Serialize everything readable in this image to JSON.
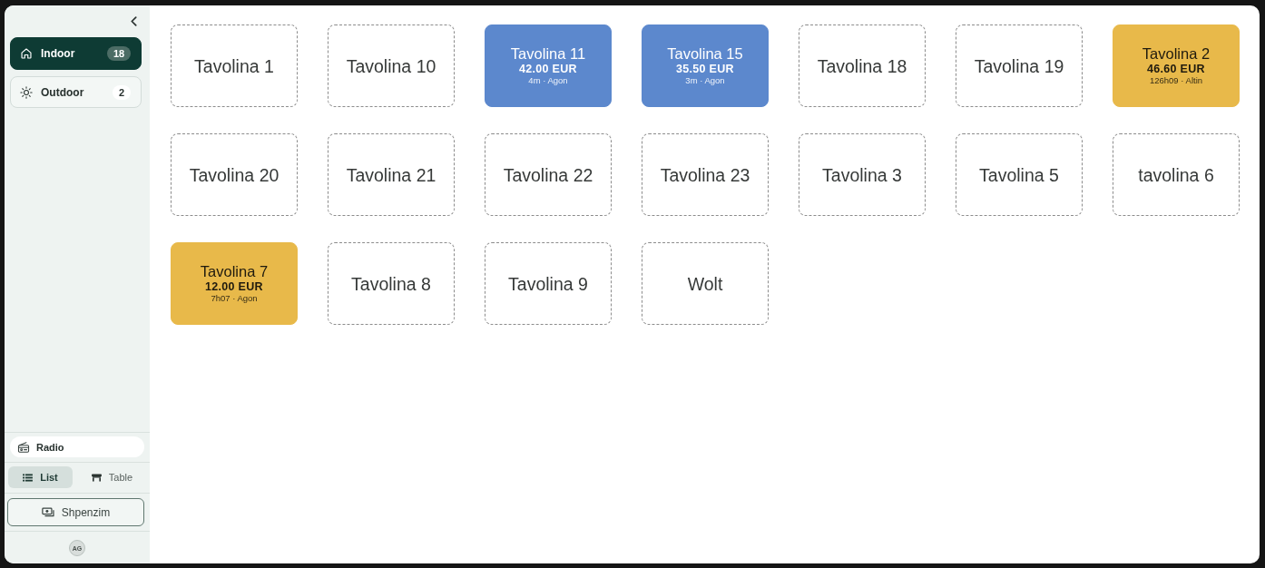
{
  "sidebar": {
    "areas": [
      {
        "label": "Indoor",
        "count": "18",
        "selected": true
      },
      {
        "label": "Outdoor",
        "count": "2",
        "selected": false
      }
    ],
    "radio": {
      "label": "Radio",
      "on": true
    },
    "view_toggle": [
      {
        "label": "List",
        "selected": true
      },
      {
        "label": "Table",
        "selected": false
      }
    ],
    "expense_button": {
      "label": "Shpenzim"
    },
    "user": {
      "initials": "AG"
    }
  },
  "tables": [
    {
      "name": "Tavolina 1",
      "kind": "free"
    },
    {
      "name": "Tavolina 10",
      "kind": "free"
    },
    {
      "name": "Tavolina 11",
      "kind": "occupied",
      "color": "#5c88cd",
      "amount": "42.00 EUR",
      "meta": "4m · Agon"
    },
    {
      "name": "Tavolina 15",
      "kind": "occupied",
      "color": "#5c88cd",
      "amount": "35.50 EUR",
      "meta": "3m · Agon"
    },
    {
      "name": "Tavolina 18",
      "kind": "free"
    },
    {
      "name": "Tavolina 19",
      "kind": "free"
    },
    {
      "name": "Tavolina 2",
      "kind": "occupied",
      "color": "#e8b94a",
      "amount": "46.60 EUR",
      "meta": "126h09 · Altin"
    },
    {
      "name": "Tavolina 20",
      "kind": "free"
    },
    {
      "name": "Tavolina 21",
      "kind": "free"
    },
    {
      "name": "Tavolina 22",
      "kind": "free"
    },
    {
      "name": "Tavolina 23",
      "kind": "free"
    },
    {
      "name": "Tavolina 3",
      "kind": "free"
    },
    {
      "name": "Tavolina 5",
      "kind": "free"
    },
    {
      "name": "tavolina 6",
      "kind": "free"
    },
    {
      "name": "Tavolina 7",
      "kind": "occupied",
      "color": "#e8b94a",
      "amount": "12.00 EUR",
      "meta": "7h07 · Agon"
    },
    {
      "name": "Tavolina 8",
      "kind": "free"
    },
    {
      "name": "Tavolina 9",
      "kind": "free"
    },
    {
      "name": "Wolt",
      "kind": "free"
    }
  ]
}
